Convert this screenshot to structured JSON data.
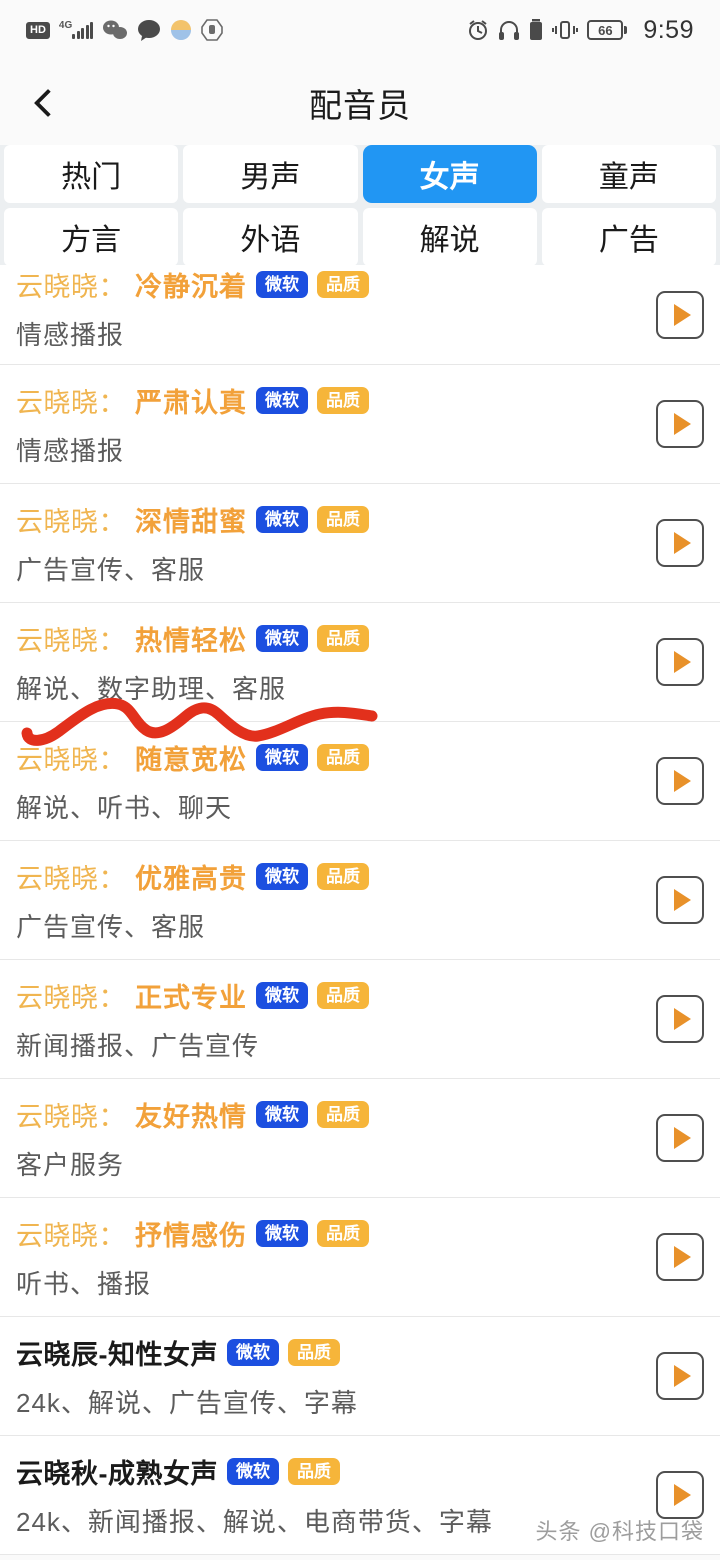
{
  "status_bar": {
    "left_icons": [
      "hd-icon",
      "4g-signal-icon",
      "wechat-icon",
      "message-icon",
      "weather-icon",
      "stop-hand-icon"
    ],
    "network_label": "4G",
    "hd_label": "HD",
    "right_icons": [
      "alarm-icon",
      "headphones-icon",
      "battery-small-icon",
      "vibrate-icon"
    ],
    "battery_level": "66",
    "time": "9:59"
  },
  "nav": {
    "back_icon": "chevron-left-icon",
    "title": "配音员"
  },
  "tabs": [
    {
      "label": "热门",
      "active": false
    },
    {
      "label": "男声",
      "active": false
    },
    {
      "label": "女声",
      "active": true
    },
    {
      "label": "童声",
      "active": false
    },
    {
      "label": "方言",
      "active": false
    },
    {
      "label": "外语",
      "active": false
    },
    {
      "label": "解说",
      "active": false
    },
    {
      "label": "广告",
      "active": false
    }
  ],
  "badges": {
    "ms": "微软",
    "qa": "品质"
  },
  "voices": [
    {
      "prefix": "云晓晓：",
      "name": "冷静沉着",
      "plain": false,
      "tags": "情感播报"
    },
    {
      "prefix": "云晓晓：",
      "name": "严肃认真",
      "plain": false,
      "tags": "情感播报"
    },
    {
      "prefix": "云晓晓：",
      "name": "深情甜蜜",
      "plain": false,
      "tags": "广告宣传、客服"
    },
    {
      "prefix": "云晓晓：",
      "name": "热情轻松",
      "plain": false,
      "tags": "解说、数字助理、客服"
    },
    {
      "prefix": "云晓晓：",
      "name": "随意宽松",
      "plain": false,
      "tags": "解说、听书、聊天"
    },
    {
      "prefix": "云晓晓：",
      "name": "优雅高贵",
      "plain": false,
      "tags": "广告宣传、客服"
    },
    {
      "prefix": "云晓晓：",
      "name": "正式专业",
      "plain": false,
      "tags": "新闻播报、广告宣传"
    },
    {
      "prefix": "云晓晓：",
      "name": "友好热情",
      "plain": false,
      "tags": "客户服务"
    },
    {
      "prefix": "云晓晓：",
      "name": "抒情感伤",
      "plain": false,
      "tags": "听书、播报"
    },
    {
      "prefix": "",
      "name": "云晓辰-知性女声",
      "plain": true,
      "tags": "24k、解说、广告宣传、字幕"
    },
    {
      "prefix": "",
      "name": "云晓秋-成熟女声",
      "plain": true,
      "tags": "24k、新闻播报、解说、电商带货、字幕"
    }
  ],
  "annotation": {
    "type": "red-squiggle",
    "color": "#e2301c"
  },
  "watermark": {
    "text": "头条 @科技口袋"
  },
  "colors": {
    "accent_blue": "#2196f3",
    "badge_blue": "#1c4fe0",
    "badge_gold": "#f6b53a",
    "voice_orange": "#f2a13a",
    "play_orange": "#e8912a",
    "annotation_red": "#e2301c"
  }
}
